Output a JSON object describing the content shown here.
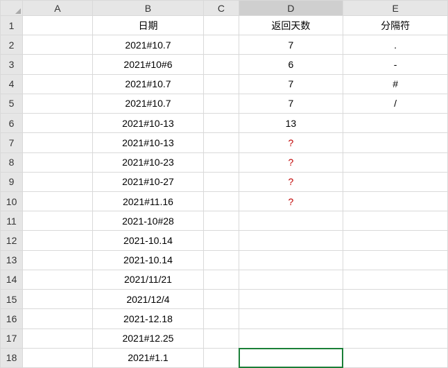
{
  "columns": {
    "A": "A",
    "B": "B",
    "C": "C",
    "D": "D",
    "E": "E"
  },
  "row_headers": [
    "1",
    "2",
    "3",
    "4",
    "5",
    "6",
    "7",
    "8",
    "9",
    "10",
    "11",
    "12",
    "13",
    "14",
    "15",
    "16",
    "17",
    "18"
  ],
  "headers": {
    "B": "日期",
    "D": "返回天数",
    "E": "分隔符"
  },
  "rows": [
    {
      "B": "2021#10.7",
      "D": "7",
      "E": "."
    },
    {
      "B": "2021#10#6",
      "D": "6",
      "E": "-"
    },
    {
      "B": "2021#10.7",
      "D": "7",
      "E": "#"
    },
    {
      "B": "2021#10.7",
      "D": "7",
      "E": "/"
    },
    {
      "B": "2021#10-13",
      "D": "13",
      "E": ""
    },
    {
      "B": "2021#10-13",
      "D": "?",
      "D_red": true,
      "E": ""
    },
    {
      "B": "2021#10-23",
      "D": "?",
      "D_red": true,
      "E": ""
    },
    {
      "B": "2021#10-27",
      "D": "?",
      "D_red": true,
      "E": ""
    },
    {
      "B": "2021#11.16",
      "D": "?",
      "D_red": true,
      "E": ""
    },
    {
      "B": "2021-10#28",
      "D": "",
      "E": ""
    },
    {
      "B": "2021-10.14",
      "D": "",
      "E": ""
    },
    {
      "B": "2021-10.14",
      "D": "",
      "E": ""
    },
    {
      "B": "2021/11/21",
      "D": "",
      "E": ""
    },
    {
      "B": "2021/12/4",
      "D": "",
      "E": ""
    },
    {
      "B": "2021-12.18",
      "D": "",
      "E": ""
    },
    {
      "B": "2021#12.25",
      "D": "",
      "E": ""
    },
    {
      "B": "2021#1.1",
      "D": "",
      "E": ""
    }
  ],
  "selection": {
    "col": "D",
    "row": 18
  }
}
